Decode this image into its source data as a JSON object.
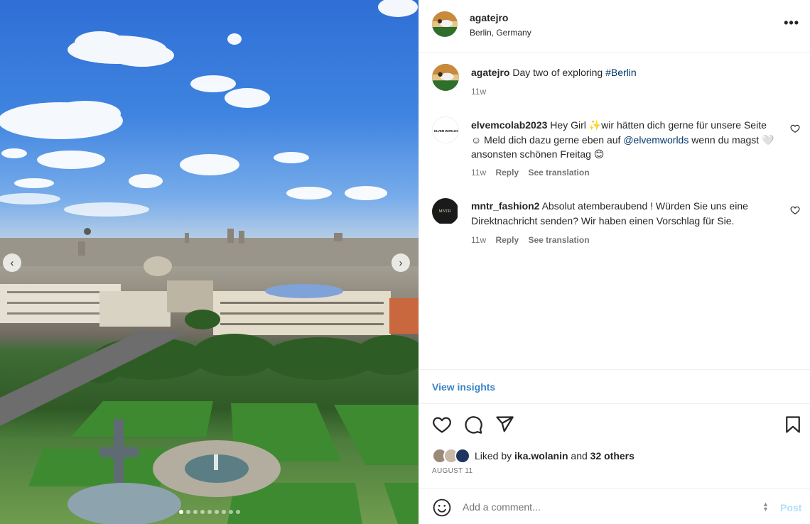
{
  "post": {
    "author": {
      "username": "agatejro",
      "location": "Berlin, Germany"
    },
    "more_label": "•••",
    "caption": {
      "username": "agatejro",
      "text": "Day two of exploring",
      "hashtag": "#Berlin",
      "time": "11w"
    },
    "comments": [
      {
        "username": "elvemcolab2023",
        "text_before": "Hey Girl ✨wir hätten dich gerne für unsere Seite ☺ Meld dich dazu gerne eben auf",
        "mention": "@elvemworlds",
        "text_after": "wenn du magst 🤍 ansonsten schönen Freitag 😊",
        "time": "11w",
        "reply_label": "Reply",
        "translate_label": "See translation",
        "avatar_text": "ELVEM WORLDS"
      },
      {
        "username": "mntr_fashion2",
        "text": "Absolut atemberaubend ! Würden Sie uns eine Direktnachricht senden? Wir haben einen Vorschlag für Sie.",
        "time": "11w",
        "reply_label": "Reply",
        "translate_label": "See translation",
        "avatar_text": "MNTR"
      }
    ],
    "insights_label": "View insights",
    "likes": {
      "prefix": "Liked by",
      "user": "ika.wolanin",
      "middle": "and",
      "others": "32 others"
    },
    "date": "AUGUST 11",
    "add_comment": {
      "placeholder": "Add a comment...",
      "post_label": "Post"
    },
    "carousel": {
      "slide_count": 9,
      "active_index": 0,
      "prev_glyph": "‹",
      "next_glyph": "›"
    }
  },
  "colors": {
    "link": "#00376b",
    "insights": "#3c84c6",
    "post_button_disabled": "#b2dffc",
    "muted_text": "#737373",
    "divider": "#efefef"
  },
  "icons": [
    "more-icon",
    "heart-icon",
    "comment-icon",
    "share-icon",
    "bookmark-icon",
    "emoji-icon",
    "resize-icon",
    "carousel-prev-icon",
    "carousel-next-icon"
  ]
}
